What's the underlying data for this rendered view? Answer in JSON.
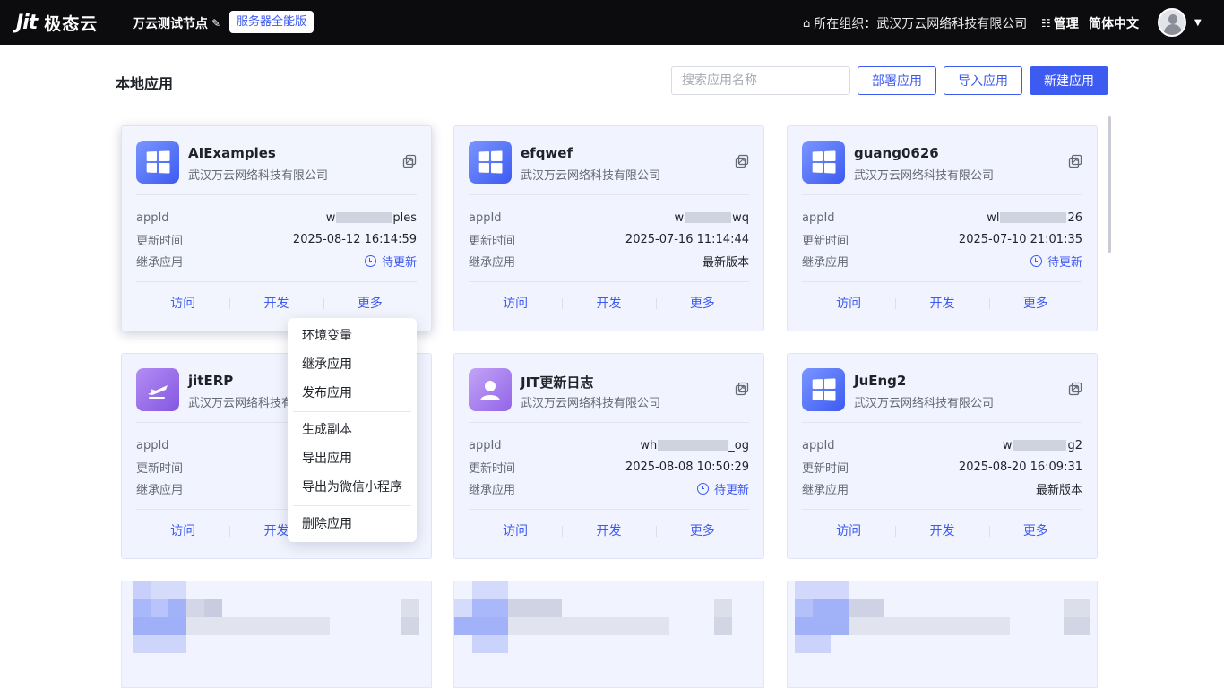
{
  "topbar": {
    "logo_mark": "Jit",
    "logo_text": "极态云",
    "node_name": "万云测试节点",
    "edition": "服务器全能版",
    "org": "所在组织：武汉万云网络科技有限公司",
    "manage": "管理",
    "language": "简体中文"
  },
  "header": {
    "title": "本地应用",
    "search_placeholder": "搜索应用名称",
    "deploy_label": "部署应用",
    "import_label": "导入应用",
    "new_label": "新建应用"
  },
  "labels": {
    "app_id": "appId",
    "updated": "更新时间",
    "inherit": "继承应用",
    "visit": "访问",
    "develop": "开发",
    "more": "更多"
  },
  "cards": [
    {
      "name": "AIExamples",
      "org": "武汉万云网络科技有限公司",
      "id_prefix": "w",
      "id_suffix": "ples",
      "updated": "2025-08-12 16:14:59",
      "inherit": "待更新",
      "icon": "windows-icon"
    },
    {
      "name": "efqwef",
      "org": "武汉万云网络科技有限公司",
      "id_prefix": "w",
      "id_suffix": "wq",
      "updated": "2025-07-16 11:14:44",
      "inherit": "最新版本",
      "icon": "windows-icon"
    },
    {
      "name": "guang0626",
      "org": "武汉万云网络科技有限公司",
      "id_prefix": "wl",
      "id_suffix": "26",
      "updated": "2025-07-10 21:01:35",
      "inherit": "待更新",
      "icon": "windows-icon"
    },
    {
      "name": "jitERP",
      "org": "武汉万云网络科技有限公司",
      "id_prefix": "",
      "id_suffix": "",
      "updated": "",
      "inherit": "",
      "icon": "airplane-icon"
    },
    {
      "name": "JIT更新日志",
      "org": "武汉万云网络科技有限公司",
      "id_prefix": "wh",
      "id_suffix": "_og",
      "updated": "2025-08-08 10:50:29",
      "inherit": "待更新",
      "icon": "user-icon"
    },
    {
      "name": "JuEng2",
      "org": "武汉万云网络科技有限公司",
      "id_prefix": "w",
      "id_suffix": "g2",
      "updated": "2025-08-20 16:09:31",
      "inherit": "最新版本",
      "icon": "windows-icon"
    }
  ],
  "menu": {
    "items": [
      "环境变量",
      "继承应用",
      "发布应用",
      "生成副本",
      "导出应用",
      "导出为微信小程序",
      "删除应用"
    ]
  },
  "colors": {
    "accent": "#3d5af1",
    "topbar": "#0c0c0e",
    "card_bg": "#f1f3fe"
  }
}
